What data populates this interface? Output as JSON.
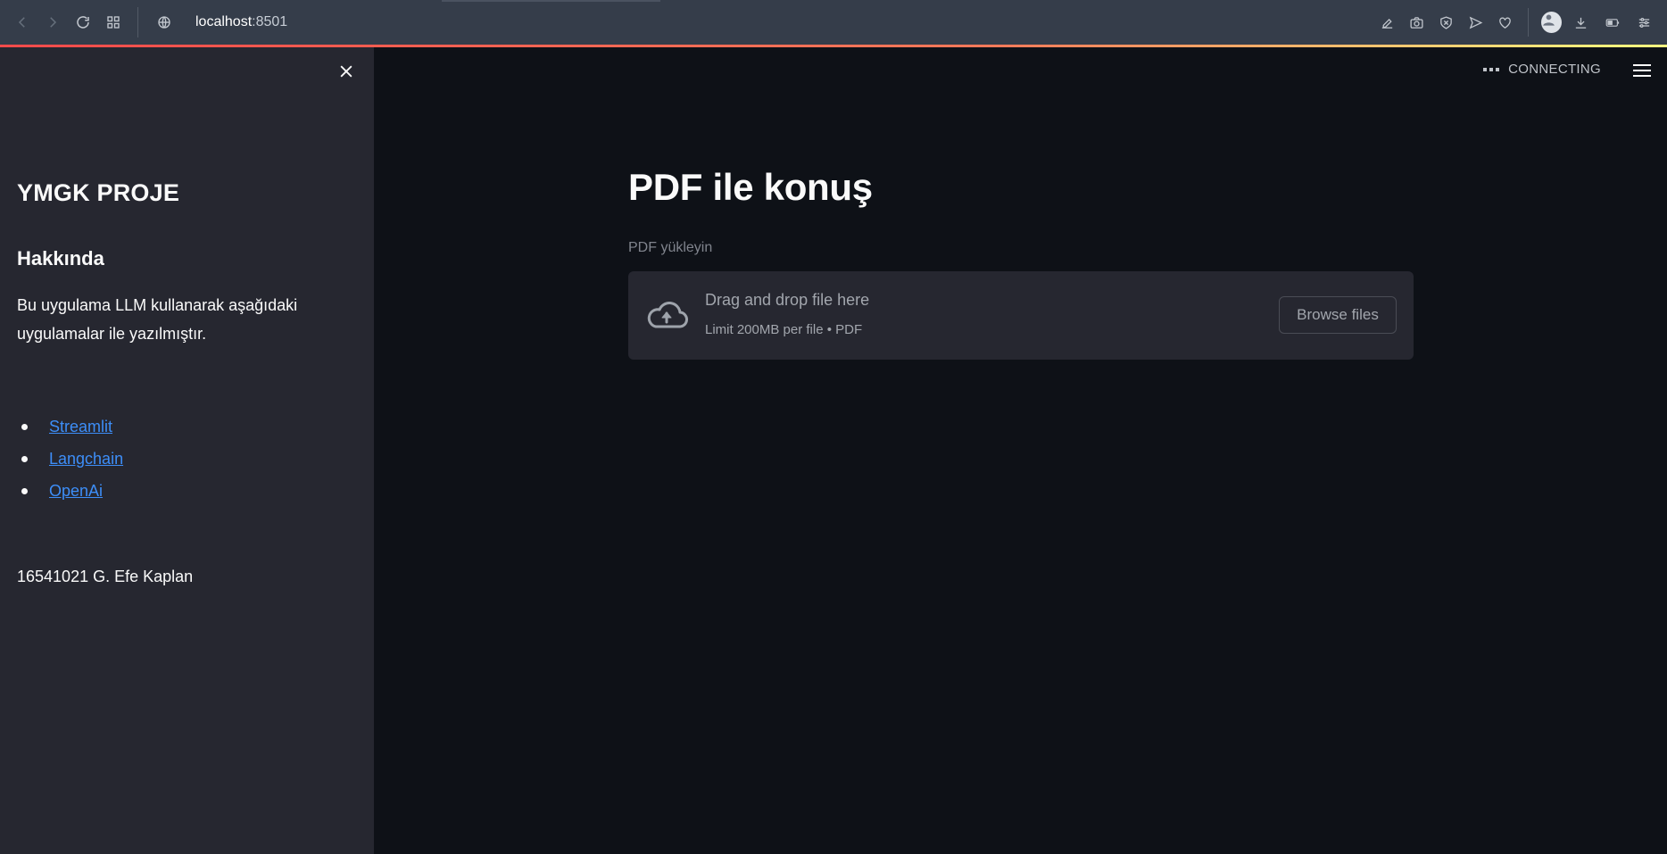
{
  "browser": {
    "host": "localhost",
    "port": ":8501"
  },
  "sidebar": {
    "title": "YMGK PROJE",
    "about_heading": "Hakkında",
    "description": "Bu uygulama LLM kullanarak aşağıdaki uygulamalar ile yazılmıştır.",
    "links": [
      {
        "label": "Streamlit"
      },
      {
        "label": "Langchain"
      },
      {
        "label": "OpenAi"
      }
    ],
    "footer": "16541021 G. Efe Kaplan"
  },
  "header": {
    "status": "CONNECTING"
  },
  "main": {
    "title": "PDF ile konuş",
    "uploader": {
      "label": "PDF yükleyin",
      "drop_text": "Drag and drop file here",
      "limit_text": "Limit 200MB per file • PDF",
      "browse_label": "Browse files"
    }
  },
  "colors": {
    "sidebar_bg": "#262730",
    "main_bg": "#0e1117",
    "link": "#3d8ef8",
    "accent_gradient_start": "#ff4b4b",
    "accent_gradient_end": "#fffd80"
  },
  "icons": [
    "back-arrow-icon",
    "forward-arrow-icon",
    "reload-icon",
    "grid-icon",
    "globe-icon",
    "close-icon",
    "cloud-upload-icon",
    "hamburger-menu-icon"
  ]
}
